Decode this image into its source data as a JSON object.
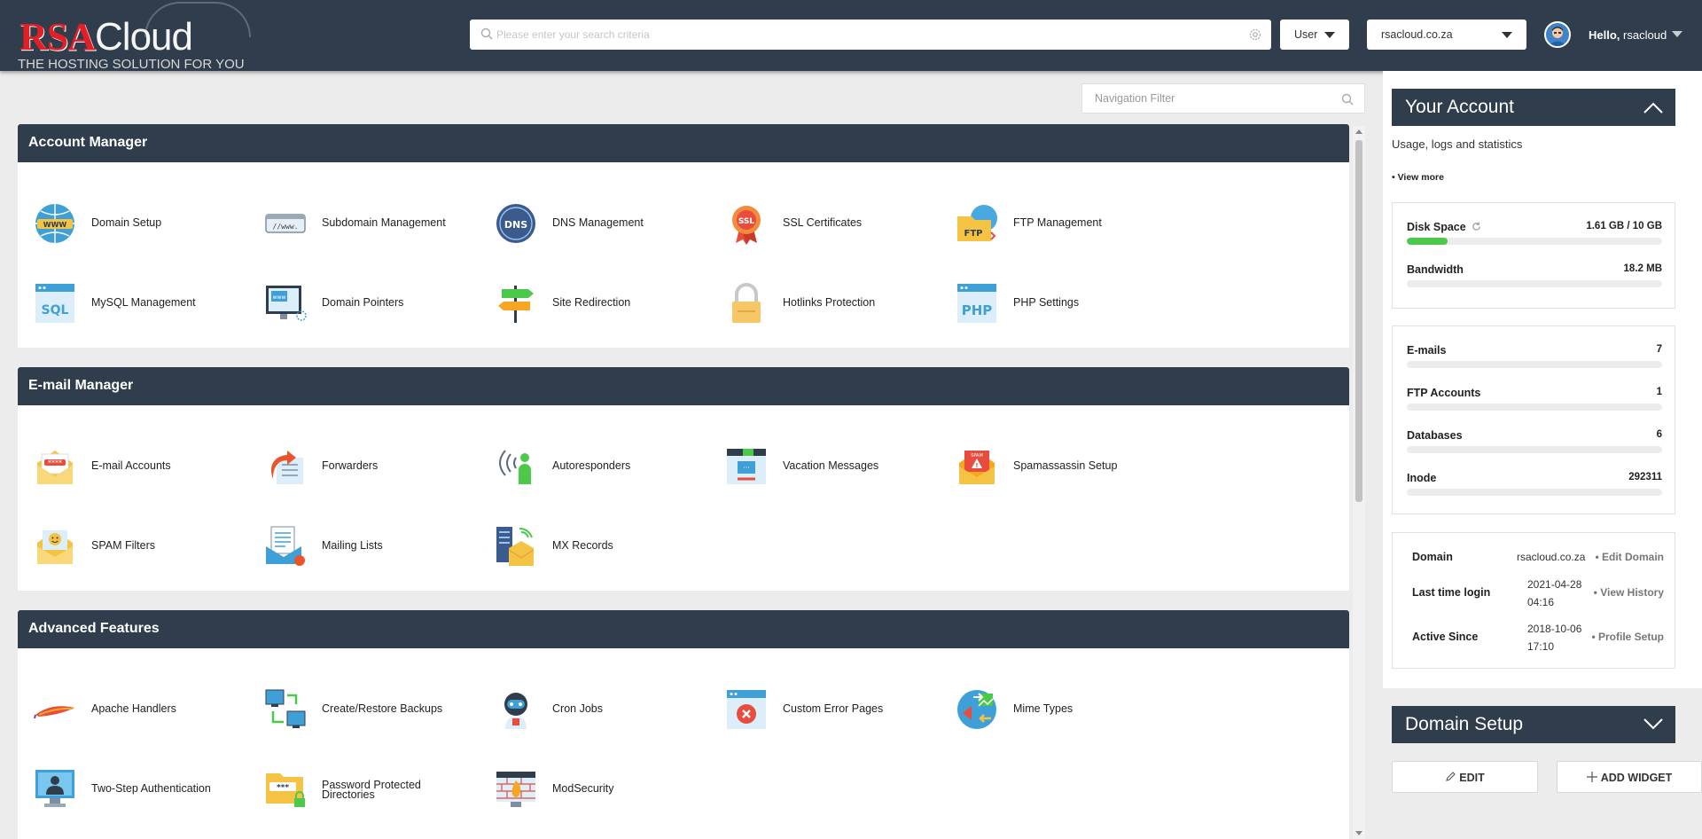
{
  "header": {
    "logo_rsa": "RSA",
    "logo_cloud": "Cloud",
    "logo_tagline": "THE HOSTING SOLUTION FOR YOU",
    "search_placeholder": "Please enter your search criteria",
    "user_dropdown": "User",
    "domain_dropdown": "rsacloud.co.za",
    "hello_prefix": "Hello,",
    "username": "rsacloud"
  },
  "nav_filter": {
    "placeholder": "Navigation Filter"
  },
  "sections": [
    {
      "title": "Account Manager",
      "items": [
        "Domain Setup",
        "Subdomain Management",
        "DNS Management",
        "SSL Certificates",
        "FTP Management",
        "MySQL Management",
        "Domain Pointers",
        "Site Redirection",
        "Hotlinks Protection",
        "PHP Settings"
      ]
    },
    {
      "title": "E-mail Manager",
      "items": [
        "E-mail Accounts",
        "Forwarders",
        "Autoresponders",
        "Vacation Messages",
        "Spamassassin Setup",
        "SPAM Filters",
        "Mailing Lists",
        "MX Records"
      ]
    },
    {
      "title": "Advanced Features",
      "items": [
        "Apache Handlers",
        "Create/Restore Backups",
        "Cron Jobs",
        "Custom Error Pages",
        "Mime Types",
        "Two-Step Authentication",
        "Password Protected Directories",
        "ModSecurity"
      ]
    }
  ],
  "your_account": {
    "title": "Your Account",
    "subtitle": "Usage, logs and statistics",
    "view_more": "• View more",
    "disk_space": {
      "label": "Disk Space",
      "value": "1.61 GB / 10 GB",
      "fraction": 0.161
    },
    "bandwidth": {
      "label": "Bandwidth",
      "value": "18.2 MB",
      "fraction": 0
    },
    "counts": [
      {
        "label": "E-mails",
        "value": "7"
      },
      {
        "label": "FTP Accounts",
        "value": "1"
      },
      {
        "label": "Databases",
        "value": "6"
      },
      {
        "label": "Inode",
        "value": "292311"
      }
    ],
    "info": {
      "domain_label": "Domain",
      "domain_value": "rsacloud.co.za",
      "domain_action": "• Edit Domain",
      "login_label": "Last time login",
      "login_value": "2021-04-28 04:16",
      "login_action": "• View History",
      "active_label": "Active Since",
      "active_value": "2018-10-06 17:10",
      "active_action": "• Profile Setup"
    }
  },
  "domain_setup_widget": {
    "title": "Domain Setup"
  },
  "buttons": {
    "edit": "EDIT",
    "add_widget": "ADD WIDGET"
  }
}
